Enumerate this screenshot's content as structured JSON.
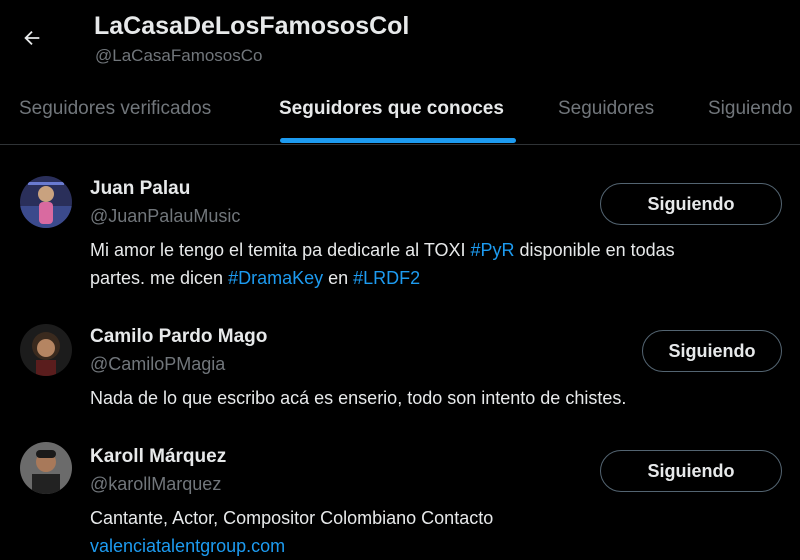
{
  "header": {
    "title": "LaCasaDeLosFamososCol",
    "handle": "@LaCasaFamososCo",
    "back_icon": "arrow-left-icon"
  },
  "tabs": [
    {
      "label": "Seguidores verificados",
      "active": false
    },
    {
      "label": "Seguidores que conoces",
      "active": true
    },
    {
      "label": "Seguidores",
      "active": false
    },
    {
      "label": "Siguiendo",
      "active": false
    }
  ],
  "colors": {
    "background": "#000000",
    "accent": "#1d9bf0",
    "text": "#e7e9ea",
    "muted": "#71767b",
    "border": "#2f3336"
  },
  "users": [
    {
      "name": "Juan Palau",
      "handle": "@JuanPalauMusic",
      "button_label": "Siguiendo",
      "bio_line1_text": "Mi amor le tengo el temita pa dedicarle al TOXI ",
      "bio_tag1": "#PyR",
      "bio_line1_end": " disponible en todas",
      "bio_line2_text": "partes. me dicen ",
      "bio_tag2": "#DramaKey",
      "bio_line2_mid": " en ",
      "bio_tag3": "#LRDF2"
    },
    {
      "name": "Camilo Pardo Mago",
      "handle": "@CamiloPMagia",
      "button_label": "Siguiendo",
      "bio": "Nada de lo que escribo acá es enserio, todo son intento de chistes."
    },
    {
      "name": "Karoll Márquez",
      "handle": "@karollMarquez",
      "button_label": "Siguiendo",
      "bio": "Cantante, Actor, Compositor Colombiano Contacto",
      "bio_link": "valenciatalentgroup.com"
    }
  ]
}
